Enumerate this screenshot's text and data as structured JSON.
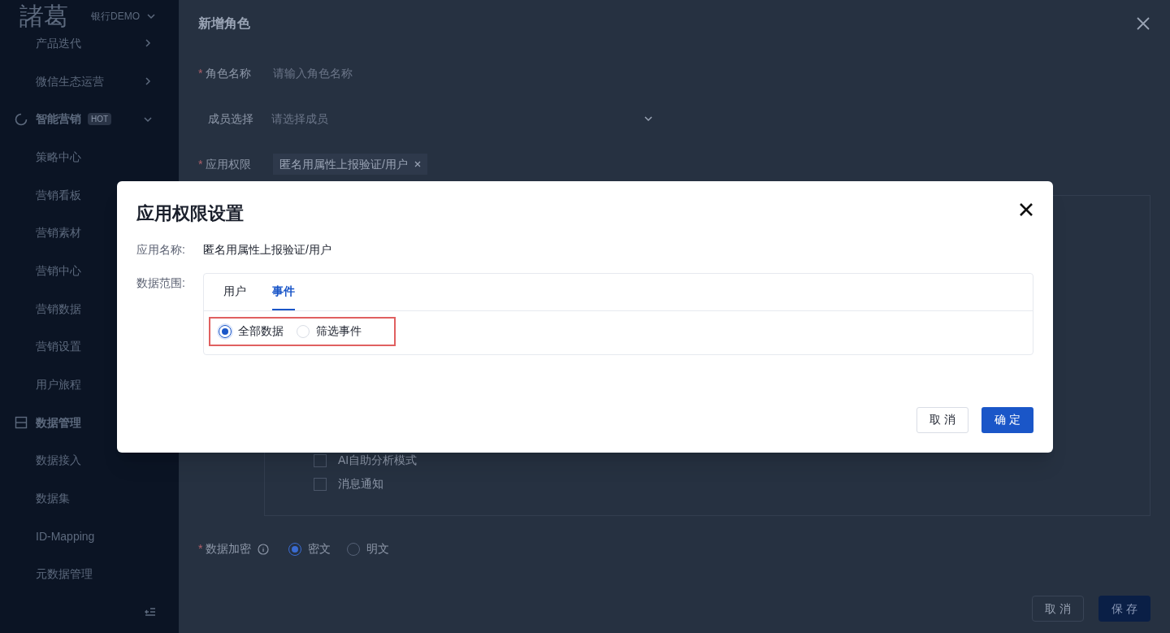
{
  "sidebar": {
    "logo": "諸葛",
    "org": "银行DEMO",
    "items": [
      {
        "kind": "item",
        "label": "产品迭代",
        "arrow": true
      },
      {
        "kind": "item",
        "label": "微信生态运营",
        "arrow": true
      },
      {
        "kind": "group",
        "label": "智能营销",
        "badge": "HOT",
        "arrow": true
      },
      {
        "kind": "item",
        "label": "策略中心",
        "arrow": false
      },
      {
        "kind": "item",
        "label": "营销看板"
      },
      {
        "kind": "item",
        "label": "营销素材"
      },
      {
        "kind": "item",
        "label": "营销中心"
      },
      {
        "kind": "item",
        "label": "营销数据"
      },
      {
        "kind": "item",
        "label": "营销设置"
      },
      {
        "kind": "item",
        "label": "用户旅程"
      },
      {
        "kind": "group",
        "label": "数据管理"
      },
      {
        "kind": "item",
        "label": "数据接入",
        "arrow": false
      },
      {
        "kind": "item",
        "label": "数据集",
        "arrow": false
      },
      {
        "kind": "item",
        "label": "ID-Mapping",
        "arrow": false
      },
      {
        "kind": "item",
        "label": "元数据管理",
        "arrow": false
      }
    ]
  },
  "drawer": {
    "title": "新增角色",
    "fields": [
      {
        "kind": "input",
        "required_mark": "*",
        "label": "角色名称",
        "placeholder": "请输入角色名称"
      },
      {
        "kind": "select",
        "label": "成员选择",
        "placeholder": "请选择成员"
      },
      {
        "kind": "tags",
        "required_mark": "*",
        "label": "应用权限",
        "tags": [
          "匿名用属性上报验证/用户"
        ]
      }
    ],
    "checkboxes": [
      {
        "label": "AI自助分析模式",
        "checked": false
      },
      {
        "label": "消息通知",
        "checked": false
      }
    ],
    "encryption": {
      "required_mark": "*",
      "label": "数据加密",
      "options": [
        {
          "label": "密文",
          "selected": true
        },
        {
          "label": "明文",
          "selected": false
        }
      ]
    },
    "buttons": [
      {
        "label": "取 消",
        "kind": "secondary"
      },
      {
        "label": "保 存",
        "kind": "primary"
      }
    ]
  },
  "modal": {
    "title": "应用权限设置",
    "app_name": {
      "label": "应用名称:",
      "value": "匿名用属性上报验证/用户"
    },
    "data_scope": {
      "label": "数据范围:",
      "tabs": [
        {
          "label": "用户",
          "selected": false
        },
        {
          "label": "事件",
          "selected": true
        }
      ],
      "highlighted": true,
      "options": [
        {
          "label": "全部数据",
          "selected": true
        },
        {
          "label": "筛选事件",
          "selected": false
        }
      ]
    },
    "buttons": [
      {
        "label": "取 消",
        "kind": "secondary"
      },
      {
        "label": "确 定",
        "kind": "primary"
      }
    ]
  }
}
